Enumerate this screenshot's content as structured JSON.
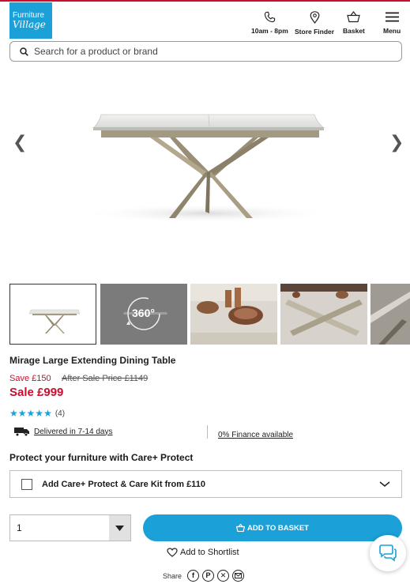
{
  "brand": {
    "logo_line1": "Furniture",
    "logo_line2": "Village"
  },
  "header": {
    "phone_label": "10am - 8pm",
    "store_finder_label": "Store Finder",
    "basket_label": "Basket",
    "menu_label": "Menu"
  },
  "search": {
    "placeholder": "Search for a product or brand"
  },
  "gallery": {
    "prev_icon": "chevron-left-icon",
    "next_icon": "chevron-right-icon",
    "spin_label": "360°"
  },
  "product": {
    "title": "Mirage Large Extending Dining Table",
    "save_text": "Save £150",
    "after_sale_text": "After Sale Price £1149",
    "sale_text": "Sale £999",
    "rating": 5,
    "review_count": "(4)"
  },
  "info": {
    "delivery_text": "Delivered in 7-14 days",
    "finance_text": "0% Finance available"
  },
  "protect": {
    "title": "Protect your furniture with Care+ Protect",
    "option_label": "Add Care+ Protect & Care Kit from £110"
  },
  "purchase": {
    "quantity": "1",
    "add_label": "ADD TO BASKET",
    "shortlist_label": "Add to Shortlist"
  },
  "share": {
    "label": "Share",
    "icons": [
      "facebook-icon",
      "pinterest-icon",
      "x-icon",
      "email-icon"
    ]
  },
  "colors": {
    "brand_blue": "#1ba0d8",
    "sale_red": "#c8102e"
  }
}
